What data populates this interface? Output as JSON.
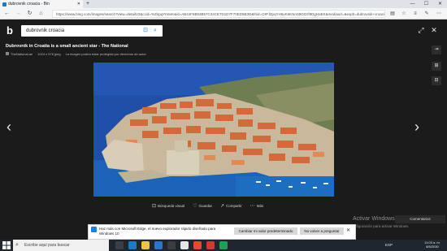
{
  "browser": {
    "tab_title": "dubrovnik croacia - Bin",
    "tab_close": "✕",
    "new_tab": "+",
    "url": "https://www.bing.com/images/search?view=detailV2&ccid=%2bpqYH6vK&id=AB44F6B53B57C34CE7D1D7F70ED5B3D&thid=OIP.fZpqYH6vK6KNnS8GDzf9DgHaEK&mediaurl=&exph=dubrovnik+croacia",
    "window_buttons": [
      "—",
      "☐",
      "✕"
    ]
  },
  "search": {
    "query": "dubrovnik croacia"
  },
  "viewer": {
    "title": "Dubrovnik in Croatia is a small ancient star - The National",
    "source": "TheNational.ae",
    "size": "1024 x 576 jpeg",
    "license": "La imagen podría estar protegida por derechos de autor",
    "actions": [
      {
        "icon": "⊡",
        "label": "Búsqueda visual"
      },
      {
        "icon": "♡",
        "label": "Guardar"
      },
      {
        "icon": "↗",
        "label": "Compartir"
      },
      {
        "icon": "⋯",
        "label": "Más"
      }
    ],
    "prev_arrow": "‹",
    "next_arrow": "›",
    "comments": "Comentarios"
  },
  "watermark": {
    "line1": "Activar Windows",
    "line2": "Ve a Configuración para activar Windows."
  },
  "notification": {
    "text": "Haz más con Microsoft Edge, el nuevo explorador rápido diseñado para Windows 10",
    "primary_button": "Cambiar mi valor predeterminado",
    "secondary_button": "No volver a preguntar",
    "close": "✕"
  },
  "taskbar": {
    "search_placeholder": "Escribe aquí para buscar",
    "clock_time": "11:03 a. m.",
    "clock_date": "8/5/2020",
    "tray_text": "ESP"
  },
  "colors": {
    "accent": "#1a7bc7",
    "viewer_bg": "#1b1b1b",
    "sea": "#1f4fa6",
    "roof": "#d4693b"
  }
}
